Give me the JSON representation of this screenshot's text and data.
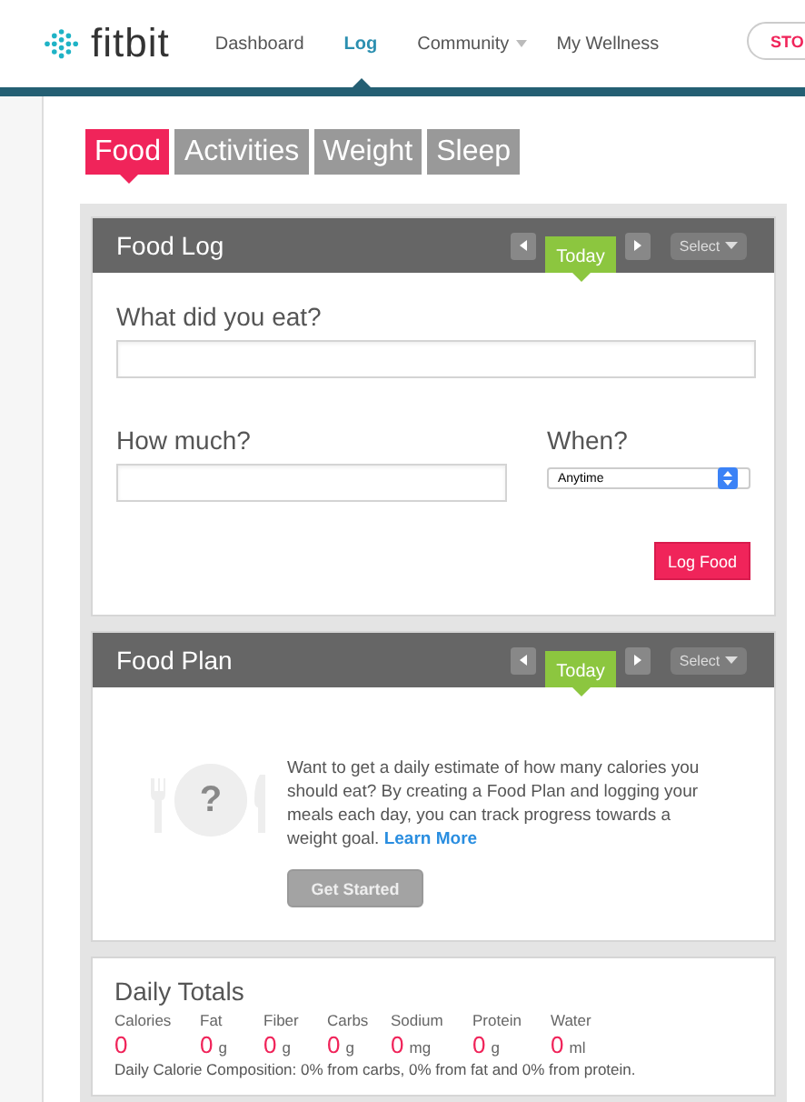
{
  "header": {
    "logo": "fitbit",
    "nav": [
      {
        "label": "Dashboard",
        "selected": false,
        "dropdown": false
      },
      {
        "label": "Log",
        "selected": true,
        "dropdown": false
      },
      {
        "label": "Community",
        "selected": false,
        "dropdown": true
      },
      {
        "label": "My Wellness",
        "selected": false,
        "dropdown": false
      }
    ],
    "store_button": "STO"
  },
  "tabs": [
    {
      "label": "Food",
      "selected": true
    },
    {
      "label": "Activities",
      "selected": false
    },
    {
      "label": "Weight",
      "selected": false
    },
    {
      "label": "Sleep",
      "selected": false
    }
  ],
  "food_log": {
    "title": "Food Log",
    "day": "Today",
    "select": "Select",
    "what_label": "What did you eat?",
    "how_much_label": "How much?",
    "when_label": "When?",
    "when_value": "Anytime",
    "submit": "Log Food"
  },
  "food_plan": {
    "title": "Food Plan",
    "day": "Today",
    "select": "Select",
    "icon_glyph": "?",
    "message": "Want to get a daily estimate of how many calories you should eat? By creating a Food Plan and logging your meals each day, you can track progress towards a weight goal.",
    "link": "Learn More",
    "button": "Get Started"
  },
  "daily_totals": {
    "title": "Daily Totals",
    "nutrients": [
      {
        "label": "Calories",
        "value": "0"
      },
      {
        "label": "Fat",
        "value": "0",
        "unit": "g"
      },
      {
        "label": "Fiber",
        "value": "0",
        "unit": "g"
      },
      {
        "label": "Carbs",
        "value": "0",
        "unit": "g"
      },
      {
        "label": "Sodium",
        "value": "0",
        "unit": "mg"
      },
      {
        "label": "Protein",
        "value": "0",
        "unit": "g"
      },
      {
        "label": "Water",
        "value": "0",
        "unit": "ml"
      }
    ],
    "composition": "Daily Calorie Composition: 0% from carbs, 0% from fat and 0% from protein."
  }
}
